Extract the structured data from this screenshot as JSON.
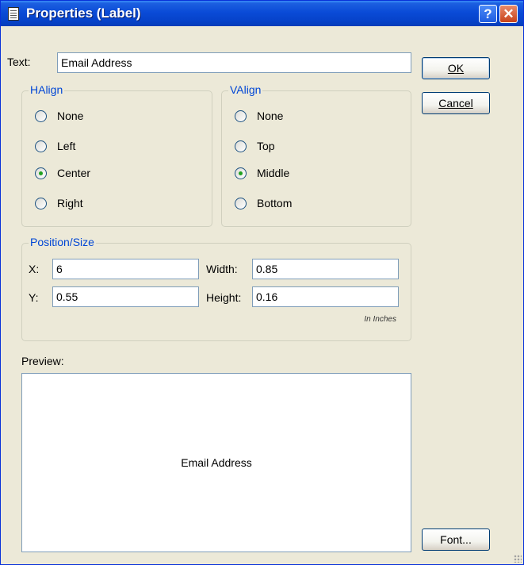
{
  "window": {
    "title": "Properties (Label)"
  },
  "text_field": {
    "label": "Text:",
    "value": "Email Address"
  },
  "buttons": {
    "ok": "OK",
    "cancel": "Cancel",
    "font": "Font..."
  },
  "halign": {
    "title": "HAlign",
    "options": [
      "None",
      "Left",
      "Center",
      "Right"
    ],
    "selected": "Center"
  },
  "valign": {
    "title": "VAlign",
    "options": [
      "None",
      "Top",
      "Middle",
      "Bottom"
    ],
    "selected": "Middle"
  },
  "position_size": {
    "title": "Position/Size",
    "x_label": "X:",
    "x_value": "6",
    "y_label": "Y:",
    "y_value": "0.55",
    "width_label": "Width:",
    "width_value": "0.85",
    "height_label": "Height:",
    "height_value": "0.16",
    "units_note": "In Inches"
  },
  "preview": {
    "label": "Preview:",
    "text": "Email Address"
  }
}
